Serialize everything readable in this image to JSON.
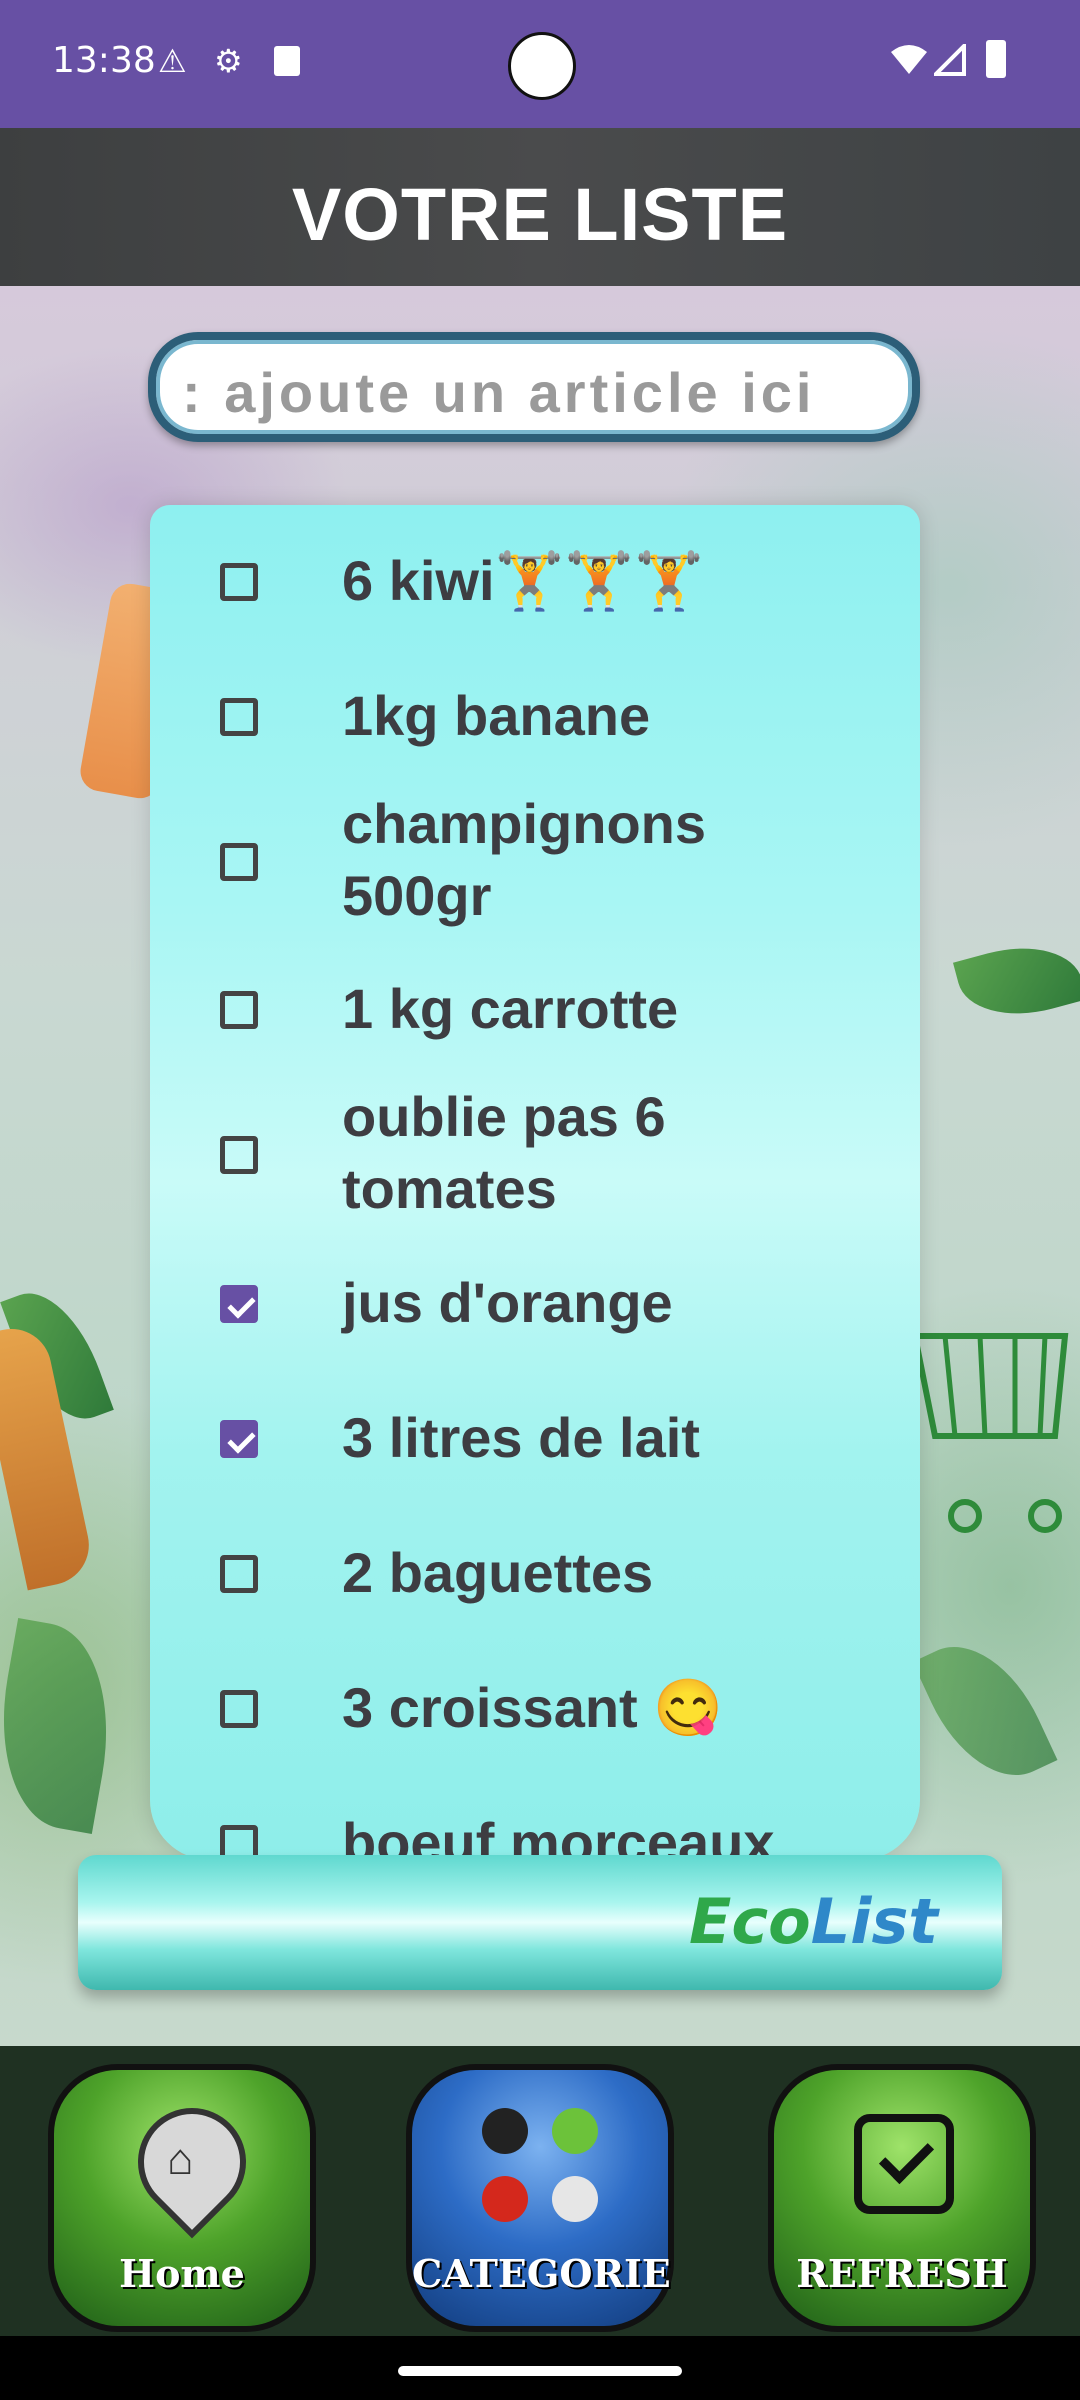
{
  "status_bar": {
    "time": "13:38",
    "icons_left": [
      "warning-icon",
      "gear-icon",
      "sd-card-icon"
    ],
    "icons_right": [
      "wifi-icon",
      "signal-icon",
      "battery-icon"
    ]
  },
  "header": {
    "title": "VOTRE LISTE"
  },
  "search": {
    "placeholder": ": ajoute un article ici"
  },
  "list": {
    "items": [
      {
        "label": "6 kiwi🏋🏋🏋",
        "checked": false
      },
      {
        "label": "1kg banane",
        "checked": false
      },
      {
        "label": "champignons 500gr",
        "checked": false
      },
      {
        "label": "1 kg carrotte",
        "checked": false
      },
      {
        "label": "oublie pas 6 tomates",
        "checked": false
      },
      {
        "label": "jus d'orange",
        "checked": true
      },
      {
        "label": "3 litres de lait",
        "checked": true
      },
      {
        "label": "2 baguettes",
        "checked": false
      },
      {
        "label": "3 croissant 😋",
        "checked": false
      },
      {
        "label": "boeuf morceaux",
        "checked": false
      }
    ]
  },
  "logo": {
    "eco": "Eco",
    "list": "List"
  },
  "bottom_nav": {
    "home": "Home",
    "categorie": "CATEGORIE",
    "refresh": "REFRESH"
  },
  "colors": {
    "status_bar": "#6750a4",
    "checkbox_checked": "#6750a4",
    "item_text": "#3d3d42"
  }
}
